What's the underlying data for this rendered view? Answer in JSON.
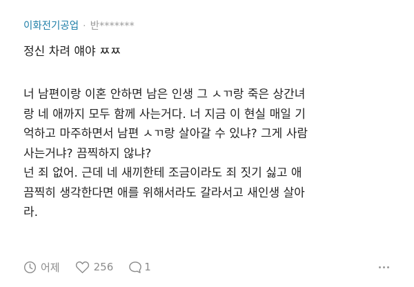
{
  "header": {
    "company": "이화전기공업",
    "separator": "·",
    "nickname": "반*******"
  },
  "post": {
    "title": "정신 차려 얘야 ㅉㅉ",
    "lines": [
      "너 남편이랑 이혼 안하면 남은 인생 그 ㅅㄲ랑 죽은 상간녀",
      "랑 네 애까지 모두 함께 사는거다. 너 지금 이 현실 매일 기",
      "억하고 마주하면서 남편 ㅅㄲ랑 살아갈 수 있냐? 그게 사람",
      "사는거냐? 끔찍하지 않냐?",
      "넌 죄 없어. 근데 네 새끼한테 조금이라도 죄 짓기 싫고 애",
      "끔찍히 생각한다면 애를 위해서라도 갈라서고 새인생 살아",
      "라."
    ]
  },
  "footer": {
    "time": "어제",
    "likes": "256",
    "comments": "1"
  },
  "icons": {
    "time": "clock-icon",
    "likes": "heart-icon",
    "comments": "comment-bubble-icon",
    "more": "more-dots-icon"
  },
  "colors": {
    "company": "#1f7fa8",
    "muted": "#8b8b8b",
    "text": "#222222"
  }
}
